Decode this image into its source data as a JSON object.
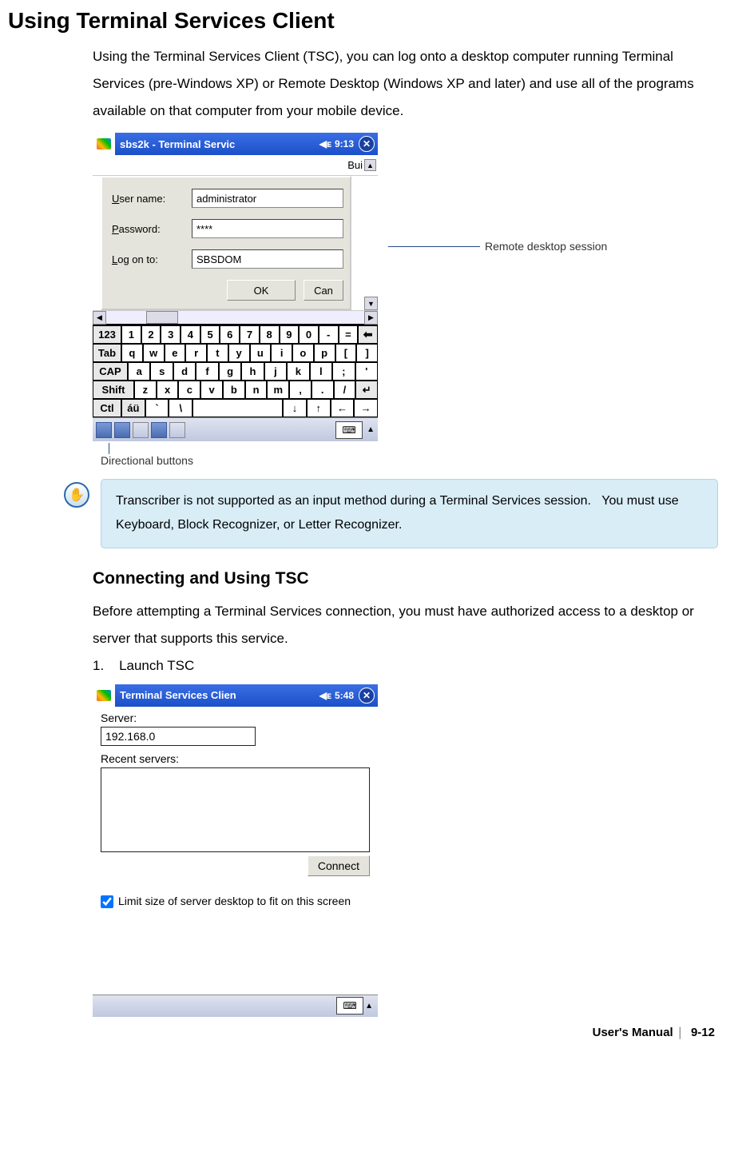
{
  "page": {
    "title": "Using Terminal Services Client",
    "intro": "Using the Terminal Services Client (TSC), you can log onto a desktop computer running Terminal Services (pre-Windows XP) or Remote Desktop (Windows XP and later) and use all of the programs available on that computer from your mobile device."
  },
  "screenshot1": {
    "title": "sbs2k - Terminal Servic",
    "clock": "9:13",
    "close": "✕",
    "bui": "Bui",
    "login": {
      "user_label": "ser name:",
      "user_value": "administrator",
      "pass_label": "assword:",
      "pass_value": "****",
      "logon_label": "og on to:",
      "logon_value": "SBSDOM",
      "ok": "OK",
      "cancel": "Can"
    },
    "keyboard": {
      "row1": [
        "123",
        "1",
        "2",
        "3",
        "4",
        "5",
        "6",
        "7",
        "8",
        "9",
        "0",
        "-",
        "=",
        "⬅"
      ],
      "row2": [
        "Tab",
        "q",
        "w",
        "e",
        "r",
        "t",
        "y",
        "u",
        "i",
        "o",
        "p",
        "[",
        "]"
      ],
      "row3": [
        "CAP",
        "a",
        "s",
        "d",
        "f",
        "g",
        "h",
        "j",
        "k",
        "l",
        ";",
        "'"
      ],
      "row4": [
        "Shift",
        "z",
        "x",
        "c",
        "v",
        "b",
        "n",
        "m",
        ",",
        ".",
        "/",
        "↵"
      ],
      "row5": [
        "Ctl",
        "áü",
        "`",
        "\\",
        " ",
        "↓",
        "↑",
        "←",
        "→"
      ]
    },
    "callouts": {
      "remote": "Remote desktop session",
      "directional": "Directional buttons"
    }
  },
  "note": {
    "text": "Transcriber is not supported as an input method during a Terminal Services session.   You must use Keyboard, Block Recognizer, or Letter Recognizer."
  },
  "section2": {
    "heading": "Connecting and Using TSC",
    "lead": "Before attempting a Terminal Services connection, you must have authorized access to a desktop or server that supports this service.",
    "step1": "1.    Launch TSC"
  },
  "screenshot2": {
    "title": "Terminal Services Clien",
    "clock": "5:48",
    "close": "✕",
    "server_label": "Server:",
    "server_value": "192.168.0",
    "recent_label": "Recent servers:",
    "connect": "Connect",
    "limit": "Limit size of server desktop to fit on this screen"
  },
  "footer": {
    "label": "User's Manual",
    "page": "9-12"
  }
}
